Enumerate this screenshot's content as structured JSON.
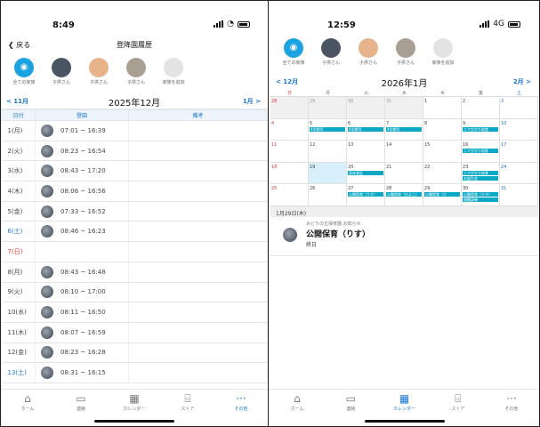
{
  "left": {
    "status": {
      "time": "8:49"
    },
    "nav": {
      "back": "戻る",
      "title": "登降園履歴"
    },
    "avatars": [
      {
        "name": "全ての家族",
        "color": "#1aa3e0"
      },
      {
        "name": "子供さん",
        "color": "#4a5561"
      },
      {
        "name": "子供さん",
        "color": "#e6b38a"
      },
      {
        "name": "子供さん",
        "color": "#a89f92"
      },
      {
        "name": "家族を追加",
        "color": "#e3e3e3"
      }
    ],
    "month": {
      "prev": "< 11月",
      "current": "2025年12月",
      "next": "1月 >"
    },
    "columns": [
      "日付",
      "登園",
      "備考"
    ],
    "rows": [
      {
        "day": "1(月)",
        "time": "07:01 ~ 16:39",
        "kind": ""
      },
      {
        "day": "2(火)",
        "time": "08:23 ~ 16:54",
        "kind": ""
      },
      {
        "day": "3(水)",
        "time": "08:43 ~ 17:20",
        "kind": ""
      },
      {
        "day": "4(木)",
        "time": "08:06 ~ 16:56",
        "kind": ""
      },
      {
        "day": "5(金)",
        "time": "07:33 ~ 16:52",
        "kind": ""
      },
      {
        "day": "6(土)",
        "time": "08:46 ~ 16:23",
        "kind": "hol"
      },
      {
        "day": "7(日)",
        "time": "",
        "kind": "sun"
      },
      {
        "day": "8(月)",
        "time": "08:43 ~ 16:48",
        "kind": ""
      },
      {
        "day": "9(火)",
        "time": "08:10 ~ 17:00",
        "kind": ""
      },
      {
        "day": "10(水)",
        "time": "08:11 ~ 16:50",
        "kind": ""
      },
      {
        "day": "11(木)",
        "time": "08:07 ~ 16:59",
        "kind": ""
      },
      {
        "day": "12(金)",
        "time": "08:23 ~ 16:28",
        "kind": ""
      },
      {
        "day": "13(土)",
        "time": "08:31 ~ 16:15",
        "kind": "hol"
      }
    ],
    "tabs": [
      {
        "label": "ホーム",
        "icon": "⌂",
        "active": false
      },
      {
        "label": "連絡",
        "icon": "▭",
        "active": false
      },
      {
        "label": "カレンダー",
        "icon": "▦",
        "active": false
      },
      {
        "label": "ストア",
        "icon": "⌸",
        "active": false
      },
      {
        "label": "その他",
        "icon": "···",
        "active": true
      }
    ]
  },
  "right": {
    "status": {
      "time": "12:59",
      "network": "4G"
    },
    "avatars": [
      {
        "name": "全ての家族",
        "color": "#1aa3e0"
      },
      {
        "name": "子供さん",
        "color": "#4a5561"
      },
      {
        "name": "子供さん",
        "color": "#e6b38a"
      },
      {
        "name": "子供さん",
        "color": "#a89f92"
      },
      {
        "name": "家族を追加",
        "color": "#e3e3e3"
      }
    ],
    "month": {
      "prev": "< 12月",
      "current": "2026年1月",
      "next": "2月 >"
    },
    "weekdays": [
      "日",
      "月",
      "火",
      "水",
      "木",
      "金",
      "土"
    ],
    "weeks": [
      [
        {
          "n": "28",
          "out": true
        },
        {
          "n": "29",
          "out": true
        },
        {
          "n": "30",
          "out": true
        },
        {
          "n": "31",
          "out": true
        },
        {
          "n": "1"
        },
        {
          "n": "2"
        },
        {
          "n": "3"
        }
      ],
      [
        {
          "n": "4"
        },
        {
          "n": "5",
          "ev": [
            "4学期号"
          ]
        },
        {
          "n": "6",
          "ev": [
            "4学期号"
          ]
        },
        {
          "n": "7",
          "ev": [
            "4学期号"
          ]
        },
        {
          "n": "8"
        },
        {
          "n": "9",
          "ev": [
            "ニアぴかり給食"
          ]
        },
        {
          "n": "10"
        }
      ],
      [
        {
          "n": "11"
        },
        {
          "n": "12"
        },
        {
          "n": "13"
        },
        {
          "n": "14"
        },
        {
          "n": "15"
        },
        {
          "n": "16",
          "ev": [
            "ニアぴかり給食"
          ]
        },
        {
          "n": "17"
        }
      ],
      [
        {
          "n": "18"
        },
        {
          "n": "19",
          "today": true
        },
        {
          "n": "20",
          "ev": [
            "身体測定"
          ]
        },
        {
          "n": "21"
        },
        {
          "n": "22"
        },
        {
          "n": "23",
          "ev": [
            "ニアぴかり給食",
            "お誕生会"
          ]
        },
        {
          "n": "24"
        }
      ],
      [
        {
          "n": "25"
        },
        {
          "n": "26"
        },
        {
          "n": "27",
          "ev": [
            "公開保育（りす）"
          ]
        },
        {
          "n": "28",
          "ev": [
            "公開保育（ひよこ）"
          ]
        },
        {
          "n": "29",
          "ev": [
            "公開保育（り"
          ]
        },
        {
          "n": "30",
          "ev": [
            "公開保育（りす）",
            "避難訓練"
          ]
        },
        {
          "n": "31"
        }
      ]
    ],
    "selected_day": "1月29日(木)",
    "event": {
      "org": "みどりの丘保育園 お知らせ",
      "title": "公開保育（りす）",
      "sub": "終日"
    },
    "tabs": [
      {
        "label": "ホーム",
        "icon": "⌂",
        "active": false
      },
      {
        "label": "連絡",
        "icon": "▭",
        "active": false
      },
      {
        "label": "カレンダー",
        "icon": "▦",
        "active": true
      },
      {
        "label": "ストア",
        "icon": "⌸",
        "active": false
      },
      {
        "label": "その他",
        "icon": "···",
        "active": false
      }
    ]
  }
}
